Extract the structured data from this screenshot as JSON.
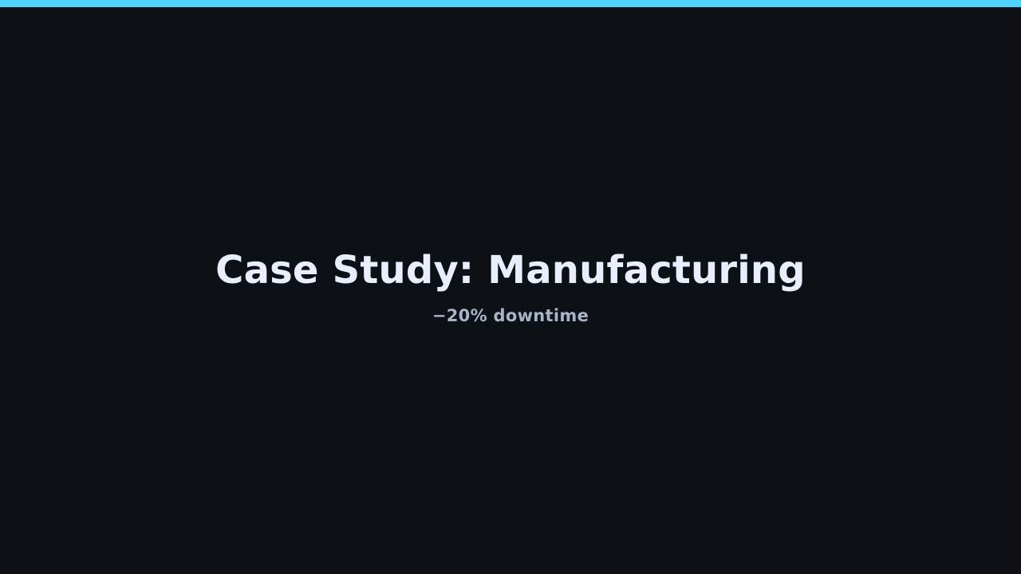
{
  "slide": {
    "title": "Case Study: Manufacturing",
    "subtitle": "−20% downtime"
  },
  "colors": {
    "background": "#0d1015",
    "accent": "#4fd1ff",
    "title": "#e8eefc",
    "subtitle": "#a9b4c8"
  }
}
